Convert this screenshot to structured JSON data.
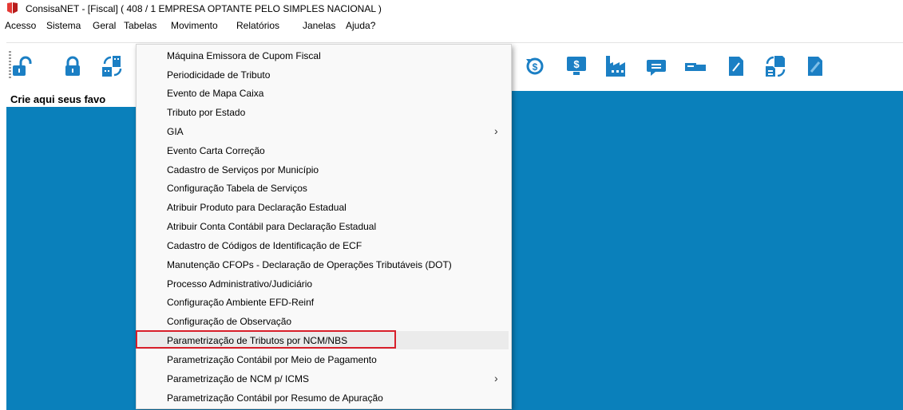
{
  "window": {
    "title": "ConsisaNET - [Fiscal] ( 408 / 1 EMPRESA OPTANTE PELO SIMPLES NACIONAL )"
  },
  "menubar": {
    "items": [
      "Acesso",
      "Sistema",
      "Geral",
      "Tabelas",
      "Movimento",
      "Relatórios",
      "Janelas",
      "Ajuda?"
    ]
  },
  "toolbar": {
    "icons": [
      "unlock-icon",
      "lock-icon",
      "building-refresh-icon",
      "money-refresh-icon",
      "money-monitor-icon",
      "factory-icon",
      "message-icon",
      "users-icon",
      "document-icon",
      "document-refresh-icon",
      "document-edit-icon"
    ],
    "icon_color": "#1b7fc4"
  },
  "favorites": {
    "label": "Crie aqui seus favo"
  },
  "dropdown": {
    "menu": "Tabelas",
    "items": [
      {
        "label": "Máquina Emissora de Cupom Fiscal",
        "submenu": false
      },
      {
        "label": "Periodicidade de Tributo",
        "submenu": false
      },
      {
        "label": "Evento de Mapa  Caixa",
        "submenu": false
      },
      {
        "label": "Tributo por Estado",
        "submenu": false
      },
      {
        "label": "GIA",
        "submenu": true
      },
      {
        "label": "Evento Carta Correção",
        "submenu": false
      },
      {
        "label": "Cadastro de Serviços por Município",
        "submenu": false
      },
      {
        "label": "Configuração Tabela de Serviços",
        "submenu": false
      },
      {
        "label": "Atribuir Produto para Declaração Estadual",
        "submenu": false
      },
      {
        "label": "Atribuir Conta Contábil para Declaração Estadual",
        "submenu": false
      },
      {
        "label": "Cadastro de Códigos de Identificação de ECF",
        "submenu": false
      },
      {
        "label": "Manutenção CFOPs - Declaração de Operações Tributáveis (DOT)",
        "submenu": false
      },
      {
        "label": "Processo Administrativo/Judiciário",
        "submenu": false
      },
      {
        "label": "Configuração Ambiente EFD-Reinf",
        "submenu": false
      },
      {
        "label": "Configuração de Observação",
        "submenu": false
      },
      {
        "label": "Parametrização de Tributos por NCM/NBS",
        "submenu": false,
        "highlighted": true
      },
      {
        "label": "Parametrização Contábil por Meio de Pagamento",
        "submenu": false
      },
      {
        "label": "Parametrização de NCM p/ ICMS",
        "submenu": true
      },
      {
        "label": "Parametrização Contábil por Resumo de Apuração",
        "submenu": false
      }
    ],
    "submenu_arrow": "›"
  },
  "colors": {
    "workspace": "#0a80bb",
    "highlight_border": "#d81f2a",
    "logo": "#e53935"
  }
}
